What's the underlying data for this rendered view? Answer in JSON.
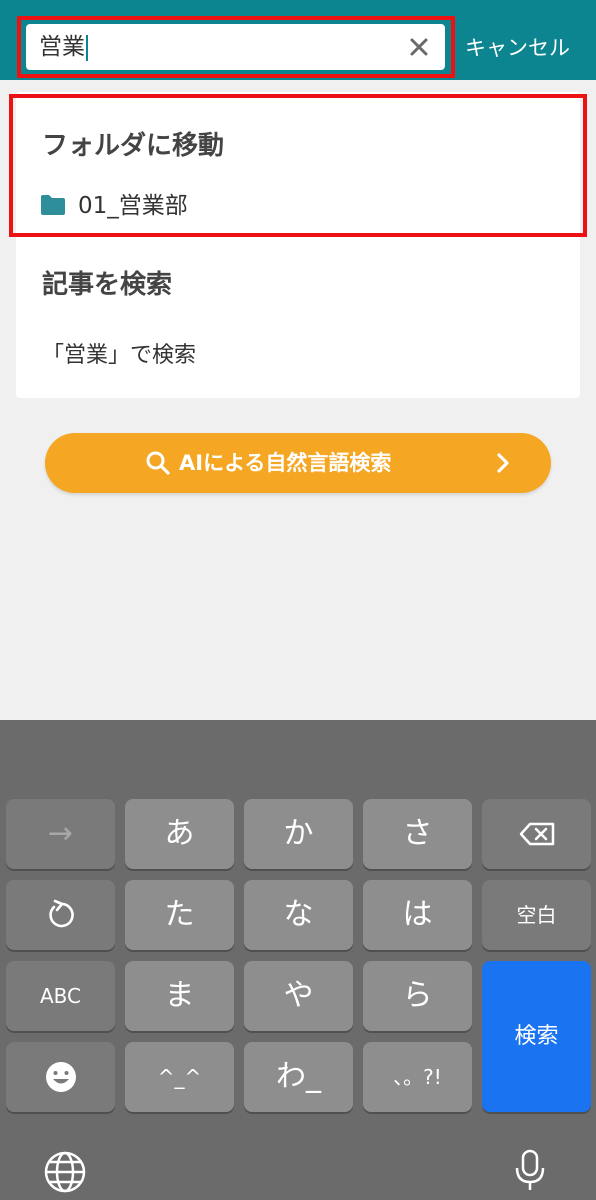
{
  "header": {
    "search_value": "営業",
    "cancel_label": "キャンセル"
  },
  "results": {
    "folder_section_title": "フォルダに移動",
    "folder_name": "01_営業部",
    "article_section_title": "記事を検索",
    "article_search_label": "「営業」で検索"
  },
  "ai_button": {
    "label": "AIによる自然言語検索"
  },
  "keyboard": {
    "row1": [
      "→",
      "あ",
      "か",
      "さ"
    ],
    "row2_right": "空白",
    "row2": [
      "た",
      "な",
      "は"
    ],
    "row3_left": "ABC",
    "row3": [
      "ま",
      "や",
      "ら"
    ],
    "row4": [
      "^_^",
      "わ_",
      "、。?!"
    ],
    "enter_label": "検索"
  },
  "colors": {
    "header": "#0d8590",
    "accent_orange": "#f5a623",
    "highlight_red": "#ee1111",
    "enter_blue": "#1a73f0"
  },
  "icons": {
    "clear": "close-icon",
    "folder": "folder-icon",
    "ai_search": "search-icon",
    "ai_chevron": "chevron-right-icon",
    "backspace": "backspace-icon",
    "undo": "undo-icon",
    "emoji": "emoji-icon",
    "globe": "globe-icon",
    "mic": "microphone-icon"
  }
}
